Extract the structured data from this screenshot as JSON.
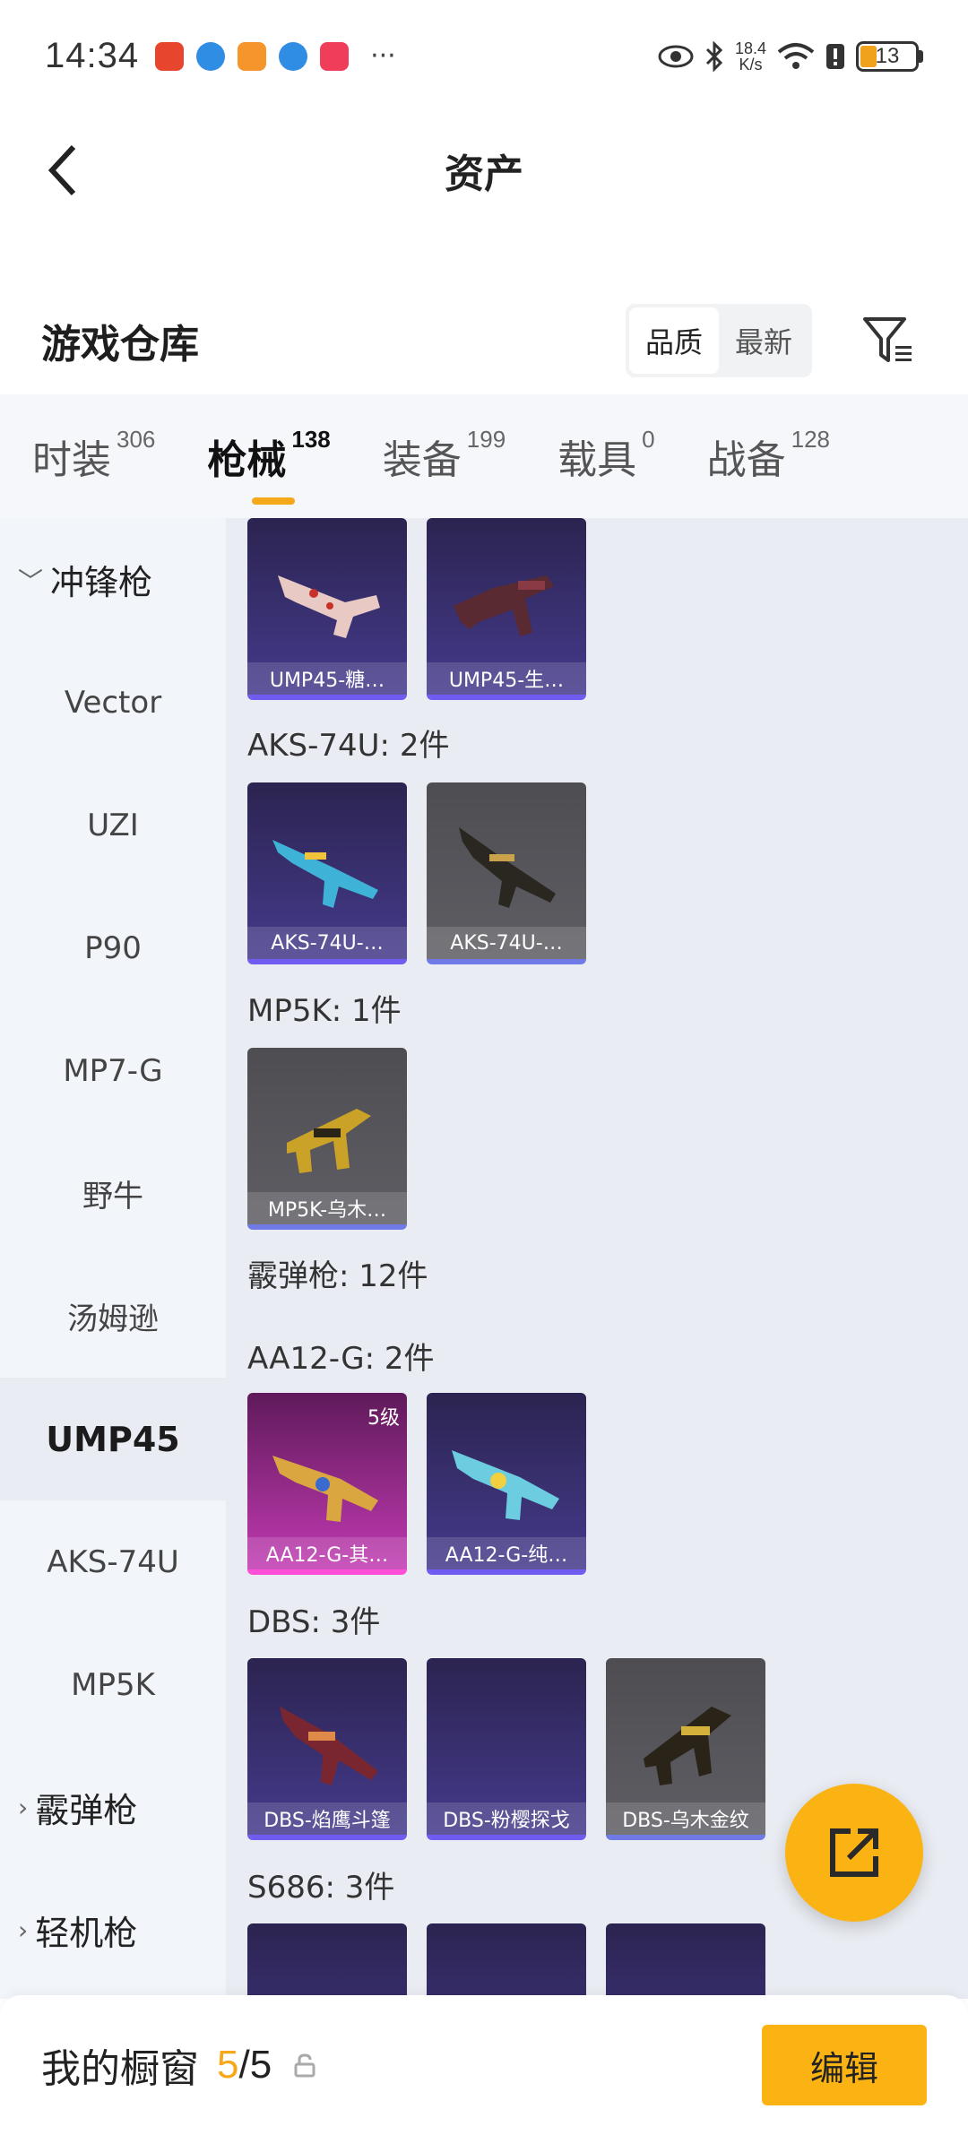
{
  "status_bar": {
    "time": "14:34",
    "more": "···",
    "speed_value": "18.4",
    "speed_unit": "K/s",
    "battery": "13"
  },
  "header": {
    "title": "资产"
  },
  "warehouse": {
    "title": "游戏仓库",
    "sort_options": [
      "品质",
      "最新"
    ],
    "active_sort": "品质"
  },
  "tabs": [
    {
      "label": "时装",
      "count": "306"
    },
    {
      "label": "枪械",
      "count": "138",
      "active": true
    },
    {
      "label": "装备",
      "count": "199"
    },
    {
      "label": "载具",
      "count": "0"
    },
    {
      "label": "战备",
      "count": "128"
    }
  ],
  "sidebar": {
    "items": [
      {
        "label": "冲锋枪",
        "type": "group",
        "expanded": true,
        "icon": "chevron-down-icon"
      },
      {
        "label": "Vector"
      },
      {
        "label": "UZI"
      },
      {
        "label": "P90"
      },
      {
        "label": "MP7-G"
      },
      {
        "label": "野牛"
      },
      {
        "label": "汤姆逊"
      },
      {
        "label": "UMP45",
        "selected": true
      },
      {
        "label": "AKS-74U"
      },
      {
        "label": "MP5K"
      },
      {
        "label": "霰弹枪",
        "type": "group",
        "expanded": false,
        "icon": "chevron-right-icon"
      },
      {
        "label": "轻机枪",
        "type": "group",
        "expanded": false,
        "icon": "chevron-right-icon"
      }
    ]
  },
  "content": {
    "ump45_cards": [
      "UMP45-糖…",
      "UMP45-生…"
    ],
    "aks_title": "AKS-74U: 2件",
    "aks_cards": [
      "AKS-74U-…",
      "AKS-74U-…"
    ],
    "mp5k_title": "MP5K: 1件",
    "mp5k_cards": [
      "MP5K-乌木…"
    ],
    "shotgun_title": "霰弹枪: 12件",
    "aa12_title": "AA12-G: 2件",
    "aa12_cards": [
      "AA12-G-其…",
      "AA12-G-纯…"
    ],
    "aa12_level": "5级",
    "dbs_title": "DBS: 3件",
    "dbs_cards": [
      "DBS-焰鹰斗篷",
      "DBS-粉樱探戈",
      "DBS-乌木金纹"
    ],
    "s686_title": "S686: 3件"
  },
  "bottom_bar": {
    "label": "我的橱窗",
    "used": "5",
    "separator": "/",
    "total": "5",
    "edit_label": "编辑"
  },
  "colors": {
    "accent": "#f6a81b",
    "button": "#fbb314",
    "purple_rarity": "#6f5cf0",
    "pink_rarity": "#ff4fd8"
  }
}
